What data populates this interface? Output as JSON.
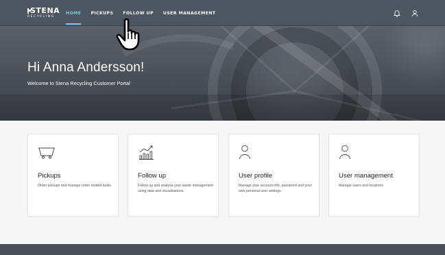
{
  "brand": {
    "name": "STENA",
    "sub": "RECYCLING"
  },
  "nav": {
    "items": [
      {
        "label": "HOME",
        "active": true
      },
      {
        "label": "PICKUPS",
        "active": false
      },
      {
        "label": "FOLLOW UP",
        "active": false
      },
      {
        "label": "USER MANAGEMENT",
        "active": false
      }
    ]
  },
  "header_icons": [
    "bell-icon",
    "user-icon"
  ],
  "hero": {
    "title": "Hi Anna Andersson!",
    "subtitle": "Welcome to Stena Recycling Customer Portal"
  },
  "cards": [
    {
      "icon": "container-icon",
      "title": "Pickups",
      "description": "Order pickups and manage order related tasks"
    },
    {
      "icon": "chart-icon",
      "title": "Follow up",
      "description": "Follow up and analyse your waste management using data and visualisations."
    },
    {
      "icon": "user-icon",
      "title": "User profile",
      "description": "Manage your account info, password and your own personal user settings"
    },
    {
      "icon": "user-icon",
      "title": "User management",
      "description": "Manage users and locations"
    }
  ],
  "colors": {
    "topbar": "#4b5660",
    "active_nav": "#7fc7ee",
    "card_bg": "#ffffff",
    "page_bg": "#f6f6f6",
    "footer": "#4b5056"
  }
}
